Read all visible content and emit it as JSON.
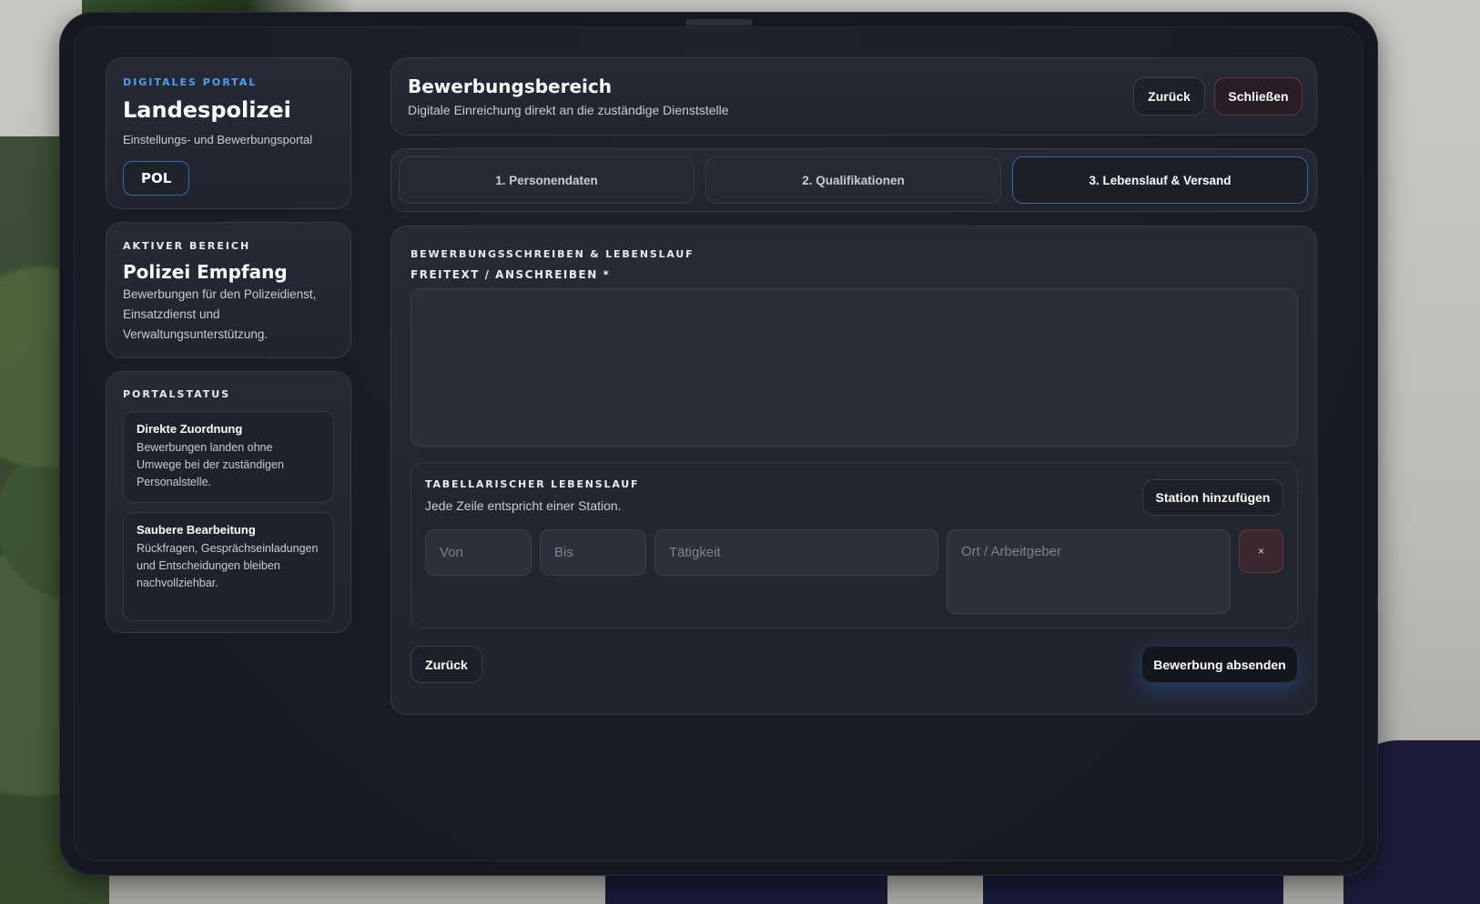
{
  "sidebar": {
    "brand": {
      "eyebrow": "DIGITALES PORTAL",
      "title": "Landespolizei",
      "subtitle": "Einstellungs- und Bewerbungsportal",
      "badge": "POL"
    },
    "active_area": {
      "eyebrow": "AKTIVER BEREICH",
      "title": "Polizei Empfang",
      "description": "Bewerbungen für den Polizeidienst, Einsatzdienst und Verwaltungsunterstützung."
    },
    "portal_status": {
      "eyebrow": "PORTALSTATUS",
      "items": [
        {
          "title": "Direkte Zuordnung",
          "description": "Bewerbungen landen ohne Umwege bei der zuständigen Personalstelle."
        },
        {
          "title": "Saubere Bearbeitung",
          "description": "Rückfragen, Gesprächseinladungen und Entscheidungen bleiben nachvollziehbar."
        }
      ]
    }
  },
  "header": {
    "title": "Bewerbungsbereich",
    "subtitle": "Digitale Einreichung direkt an die zuständige Dienststelle",
    "back_label": "Zurück",
    "close_label": "Schließen"
  },
  "steps": [
    {
      "label": "1. Personendaten",
      "active": false
    },
    {
      "label": "2. Qualifikationen",
      "active": false
    },
    {
      "label": "3. Lebenslauf & Versand",
      "active": true
    }
  ],
  "form": {
    "section_title": "BEWERBUNGSSCHREIBEN & LEBENSLAUF",
    "freetext_label": "FREITEXT / ANSCHREIBEN *",
    "freetext_value": "",
    "cv": {
      "title": "TABELLARISCHER LEBENSLAUF",
      "hint": "Jede Zeile entspricht einer Station.",
      "add_label": "Station hinzufügen",
      "row": {
        "from_placeholder": "Von",
        "to_placeholder": "Bis",
        "activity_placeholder": "Tätigkeit",
        "place_placeholder": "Ort / Arbeitgeber",
        "remove_label": "×"
      }
    },
    "back_label": "Zurück",
    "submit_label": "Bewerbung absenden"
  },
  "colors": {
    "accent": "#4f9cf2",
    "danger": "#6b3342",
    "background": "#191c26"
  }
}
